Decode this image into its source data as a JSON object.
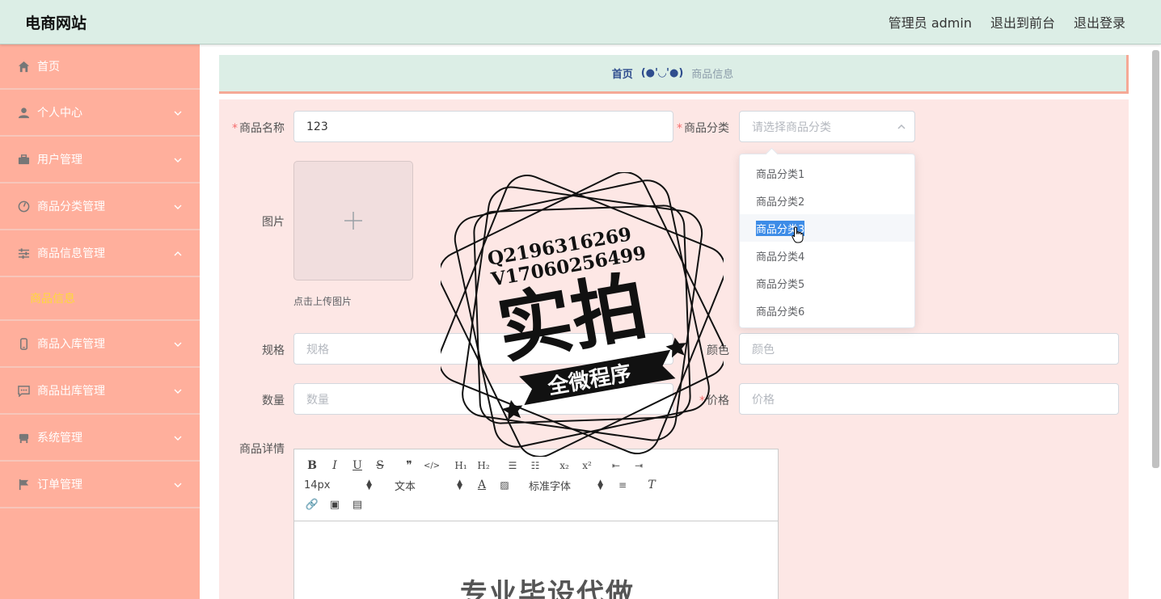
{
  "header": {
    "site_title": "电商网站",
    "admin_label": "管理员 admin",
    "to_front_label": "退出到前台",
    "logout_label": "退出登录"
  },
  "sidebar": {
    "items": [
      {
        "label": "首页",
        "icon": "home-icon"
      },
      {
        "label": "个人中心",
        "icon": "user-icon"
      },
      {
        "label": "用户管理",
        "icon": "briefcase-icon"
      },
      {
        "label": "商品分类管理",
        "icon": "gauge-icon"
      },
      {
        "label": "商品信息管理",
        "icon": "sliders-icon"
      },
      {
        "label": "商品入库管理",
        "icon": "phone-icon"
      },
      {
        "label": "商品出库管理",
        "icon": "chat-icon"
      },
      {
        "label": "系统管理",
        "icon": "chair-icon"
      },
      {
        "label": "订单管理",
        "icon": "flag-icon"
      }
    ],
    "active_sub": "商品信息"
  },
  "breadcrumb": {
    "home": "首页",
    "separator": "(●'◡'●)",
    "current": "商品信息"
  },
  "form": {
    "name_label": "商品名称",
    "name_value": "123",
    "category_label": "商品分类",
    "category_placeholder": "请选择商品分类",
    "image_label": "图片",
    "upload_tip": "点击上传图片",
    "spec_label": "规格",
    "spec_placeholder": "规格",
    "color_label": "颜色",
    "color_placeholder": "颜色",
    "qty_label": "数量",
    "qty_placeholder": "数量",
    "price_label": "价格",
    "price_placeholder": "价格",
    "detail_label": "商品详情"
  },
  "editor": {
    "font_size": "14px",
    "text_type": "文本",
    "font_family": "标准字体",
    "body_text": "专业毕设代做"
  },
  "dropdown": {
    "options": [
      "商品分类1",
      "商品分类2",
      "商品分类3",
      "商品分类4",
      "商品分类5",
      "商品分类6"
    ],
    "hovered_index": 2
  },
  "stamp": {
    "line1": "Q2196316269",
    "line2": "V17060256499",
    "big": "实拍",
    "ribbon": "全微程序"
  }
}
